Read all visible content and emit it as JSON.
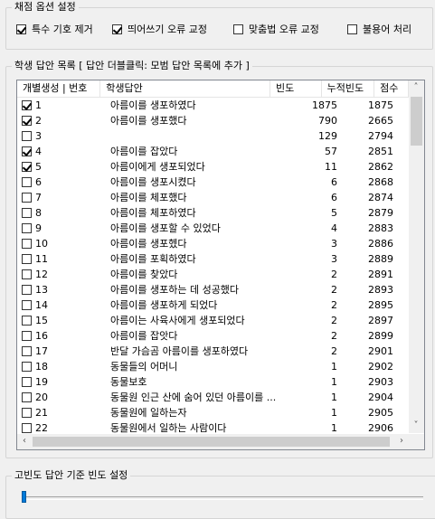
{
  "scoring_options": {
    "title": "채점 옵션 설정",
    "options": [
      {
        "label": "특수 기호 제거",
        "checked": true
      },
      {
        "label": "띄어쓰기 오류 교정",
        "checked": true
      },
      {
        "label": "맞춤법 오류 교정",
        "checked": false
      },
      {
        "label": "불용어 처리",
        "checked": false
      }
    ]
  },
  "answer_list": {
    "title": "학생 답안 목록 [ 답안 더블클릭: 모범 답안 목록에 추가 ]",
    "columns": [
      "개별생성 | 번호",
      "학생답안",
      "빈도",
      "누적빈도",
      "점수"
    ],
    "rows": [
      {
        "checked": true,
        "num": "1",
        "answer": "아름이를 생포하였다",
        "freq": "1875",
        "cum": "1875"
      },
      {
        "checked": true,
        "num": "2",
        "answer": "아름이를 생포했다",
        "freq": "790",
        "cum": "2665"
      },
      {
        "checked": false,
        "num": "3",
        "answer": "",
        "freq": "129",
        "cum": "2794"
      },
      {
        "checked": true,
        "num": "4",
        "answer": "아름이를 잡았다",
        "freq": "57",
        "cum": "2851"
      },
      {
        "checked": true,
        "num": "5",
        "answer": "아름이에게 생포되었다",
        "freq": "11",
        "cum": "2862"
      },
      {
        "checked": false,
        "num": "6",
        "answer": "아름이를 생포시켰다",
        "freq": "6",
        "cum": "2868"
      },
      {
        "checked": false,
        "num": "7",
        "answer": "아름이를 체포했다",
        "freq": "6",
        "cum": "2874"
      },
      {
        "checked": false,
        "num": "8",
        "answer": "아름이를 체포하였다",
        "freq": "5",
        "cum": "2879"
      },
      {
        "checked": false,
        "num": "9",
        "answer": "아름이를 생포할 수 있었다",
        "freq": "4",
        "cum": "2883"
      },
      {
        "checked": false,
        "num": "10",
        "answer": "아름이를 생포헸다",
        "freq": "3",
        "cum": "2886"
      },
      {
        "checked": false,
        "num": "11",
        "answer": "아름이를 포획하였다",
        "freq": "3",
        "cum": "2889"
      },
      {
        "checked": false,
        "num": "12",
        "answer": "아름이를 찾았다",
        "freq": "2",
        "cum": "2891"
      },
      {
        "checked": false,
        "num": "13",
        "answer": "아름이를 생포하는 데 성공했다",
        "freq": "2",
        "cum": "2893"
      },
      {
        "checked": false,
        "num": "14",
        "answer": "아름이를 생포하게 되었다",
        "freq": "2",
        "cum": "2895"
      },
      {
        "checked": false,
        "num": "15",
        "answer": "아름이는 사육사에게 생포되었다",
        "freq": "2",
        "cum": "2897"
      },
      {
        "checked": false,
        "num": "16",
        "answer": "아름이를 잡앗다",
        "freq": "2",
        "cum": "2899"
      },
      {
        "checked": false,
        "num": "17",
        "answer": "반달 가슴곰 아름이를 생포하였다",
        "freq": "2",
        "cum": "2901"
      },
      {
        "checked": false,
        "num": "18",
        "answer": "동물들의 어머니",
        "freq": "1",
        "cum": "2902"
      },
      {
        "checked": false,
        "num": "19",
        "answer": "동물보호",
        "freq": "1",
        "cum": "2903"
      },
      {
        "checked": false,
        "num": "20",
        "answer": "동물원 인근 산에 숨어 있던 아름이를 ...",
        "freq": "1",
        "cum": "2904"
      },
      {
        "checked": false,
        "num": "21",
        "answer": "동물원에 일하는자",
        "freq": "1",
        "cum": "2905"
      },
      {
        "checked": false,
        "num": "22",
        "answer": "동물원에서 일하는 사람이다",
        "freq": "1",
        "cum": "2906"
      }
    ]
  },
  "threshold": {
    "title": "고빈도 답안 기준 빈도 설정",
    "value_fraction": 0.0
  }
}
